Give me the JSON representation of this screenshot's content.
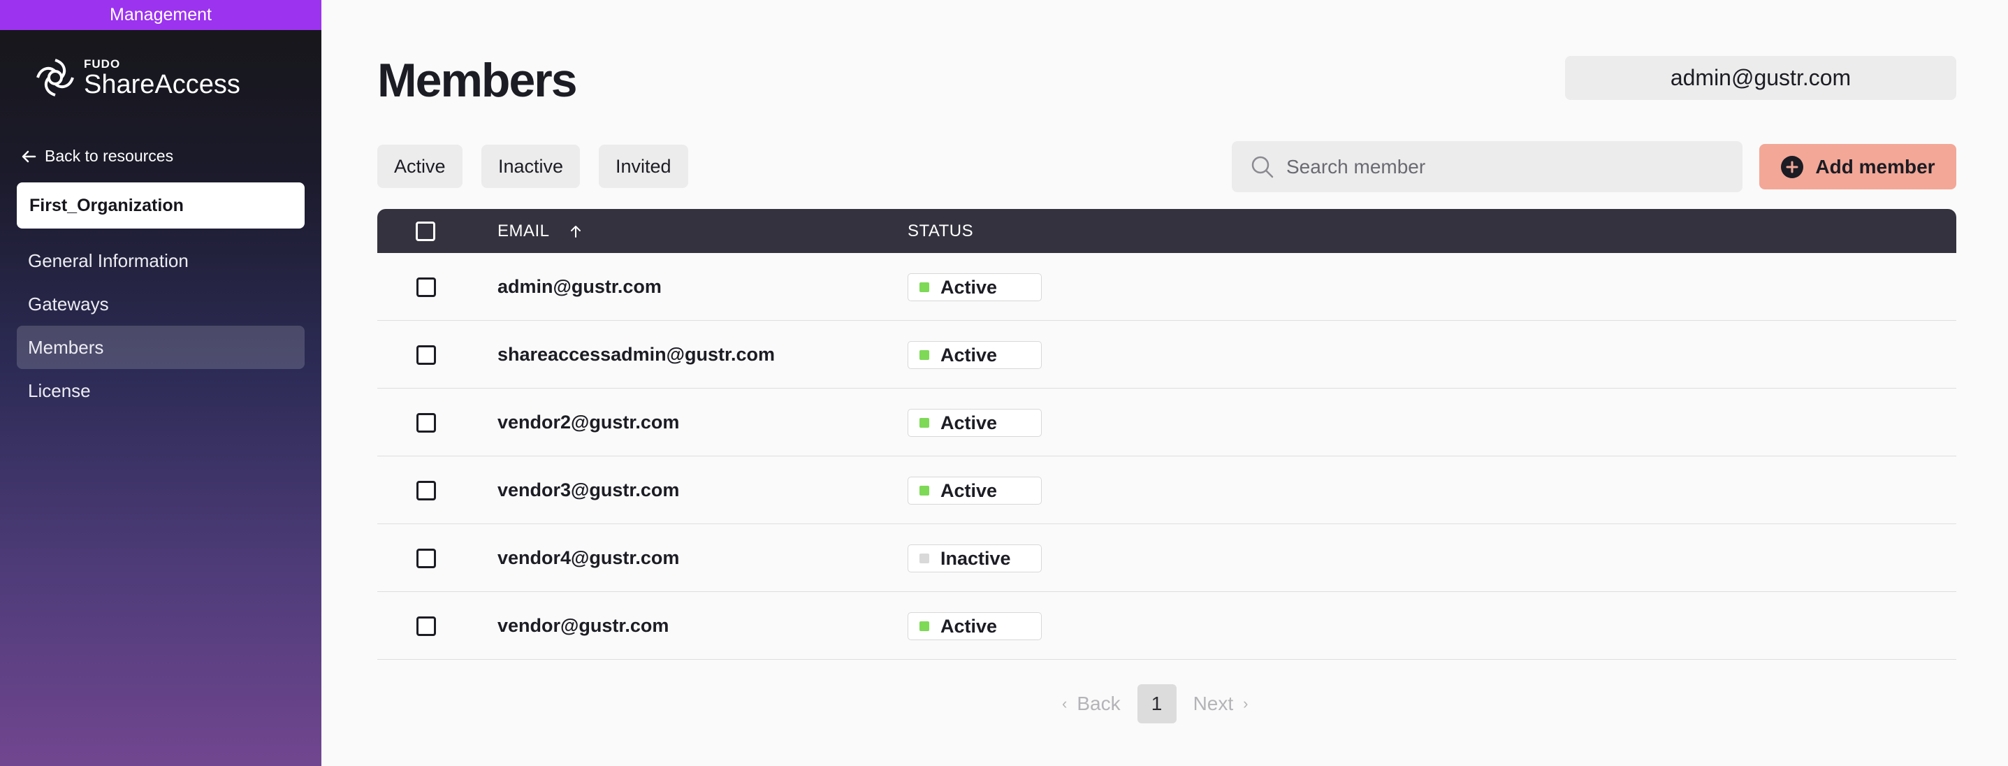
{
  "window": {
    "banner": "Management"
  },
  "brand": {
    "small": "FUDO",
    "big": "ShareAccess"
  },
  "sidebar": {
    "back_label": "Back to resources",
    "organization": "First_Organization",
    "items": [
      {
        "label": "General Information"
      },
      {
        "label": "Gateways"
      },
      {
        "label": "Members",
        "active": true
      },
      {
        "label": "License"
      }
    ]
  },
  "header": {
    "title": "Members",
    "user": "admin@gustr.com"
  },
  "filters": [
    {
      "label": "Active"
    },
    {
      "label": "Inactive"
    },
    {
      "label": "Invited"
    }
  ],
  "search": {
    "placeholder": "Search member",
    "value": ""
  },
  "add_button": {
    "label": "Add member",
    "icon": "plus-circle-icon"
  },
  "table": {
    "columns": {
      "email": "EMAIL",
      "status": "STATUS"
    },
    "sort": {
      "column": "email",
      "direction": "ascending"
    },
    "rows": [
      {
        "email": "admin@gustr.com",
        "status": "Active"
      },
      {
        "email": "shareaccessadmin@gustr.com",
        "status": "Active"
      },
      {
        "email": "vendor2@gustr.com",
        "status": "Active"
      },
      {
        "email": "vendor3@gustr.com",
        "status": "Active"
      },
      {
        "email": "vendor4@gustr.com",
        "status": "Inactive"
      },
      {
        "email": "vendor@gustr.com",
        "status": "Active"
      }
    ]
  },
  "pagination": {
    "back_label": "Back",
    "page": "1",
    "next_label": "Next"
  },
  "colors": {
    "banner": "#9b33ef",
    "add_button": "#f3a797",
    "table_header": "#33323e",
    "status_active": "#7ed957",
    "status_inactive": "#d9d9d9"
  }
}
